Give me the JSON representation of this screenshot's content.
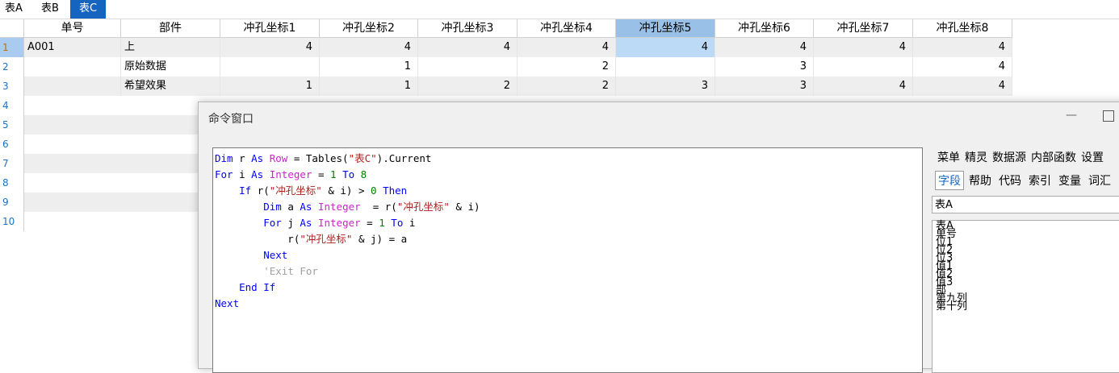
{
  "tabs": [
    {
      "label": "表A",
      "active": false
    },
    {
      "label": "表B",
      "active": false
    },
    {
      "label": "表C",
      "active": true
    }
  ],
  "grid": {
    "columns": [
      "单号",
      "部件",
      "冲孔坐标1",
      "冲孔坐标2",
      "冲孔坐标3",
      "冲孔坐标4",
      "冲孔坐标5",
      "冲孔坐标6",
      "冲孔坐标7",
      "冲孔坐标8"
    ],
    "selected_column": 6,
    "row_numbers": [
      "1",
      "2",
      "3",
      "4",
      "5",
      "6",
      "7",
      "8",
      "9",
      "10"
    ],
    "current_row": 0,
    "rows": [
      [
        "A001",
        "上",
        "4",
        "4",
        "4",
        "4",
        "4",
        "4",
        "4",
        "4"
      ],
      [
        "",
        "原始数据",
        "",
        "1",
        "",
        "2",
        "",
        "3",
        "",
        "4"
      ],
      [
        "",
        "希望效果",
        "1",
        "1",
        "2",
        "2",
        "3",
        "3",
        "4",
        "4"
      ]
    ]
  },
  "command_window": {
    "title": "命令窗口",
    "code": [
      [
        [
          "kw",
          "Dim"
        ],
        [
          "pl",
          " r "
        ],
        [
          "kw",
          "As"
        ],
        [
          "pl",
          " "
        ],
        [
          "ty",
          "Row"
        ],
        [
          "pl",
          " = Tables("
        ],
        [
          "st",
          "\"表C\""
        ],
        [
          "pl",
          ").Current"
        ]
      ],
      [
        [
          "kw",
          "For"
        ],
        [
          "pl",
          " i "
        ],
        [
          "kw",
          "As"
        ],
        [
          "pl",
          " "
        ],
        [
          "ty",
          "Integer"
        ],
        [
          "pl",
          " = "
        ],
        [
          "nm",
          "1"
        ],
        [
          "pl",
          " "
        ],
        [
          "kw",
          "To"
        ],
        [
          "pl",
          " "
        ],
        [
          "nm",
          "8"
        ]
      ],
      [
        [
          "pl",
          "    "
        ],
        [
          "kw",
          "If"
        ],
        [
          "pl",
          " r("
        ],
        [
          "st",
          "\"冲孔坐标\""
        ],
        [
          "pl",
          " & i) > "
        ],
        [
          "nm",
          "0"
        ],
        [
          "pl",
          " "
        ],
        [
          "kw",
          "Then"
        ]
      ],
      [
        [
          "pl",
          "        "
        ],
        [
          "kw",
          "Dim"
        ],
        [
          "pl",
          " a "
        ],
        [
          "kw",
          "As"
        ],
        [
          "pl",
          " "
        ],
        [
          "ty",
          "Integer"
        ],
        [
          "pl",
          "  = r("
        ],
        [
          "st",
          "\"冲孔坐标\""
        ],
        [
          "pl",
          " & i)"
        ]
      ],
      [
        [
          "pl",
          "        "
        ],
        [
          "kw",
          "For"
        ],
        [
          "pl",
          " j "
        ],
        [
          "kw",
          "As"
        ],
        [
          "pl",
          " "
        ],
        [
          "ty",
          "Integer"
        ],
        [
          "pl",
          " = "
        ],
        [
          "nm",
          "1"
        ],
        [
          "pl",
          " "
        ],
        [
          "kw",
          "To"
        ],
        [
          "pl",
          " i"
        ]
      ],
      [
        [
          "pl",
          "            r("
        ],
        [
          "st",
          "\"冲孔坐标\""
        ],
        [
          "pl",
          " & j) = a"
        ]
      ],
      [
        [
          "pl",
          "        "
        ],
        [
          "kw",
          "Next"
        ]
      ],
      [
        [
          "pl",
          "        "
        ],
        [
          "cm",
          "'Exit For"
        ]
      ],
      [
        [
          "pl",
          "    "
        ],
        [
          "kw",
          "End If"
        ]
      ],
      [
        [
          "kw",
          "Next"
        ]
      ]
    ],
    "menu": [
      "菜单",
      "精灵",
      "数据源",
      "内部函数",
      "设置"
    ],
    "panel_tabs": [
      {
        "label": "字段",
        "active": true
      },
      {
        "label": "帮助",
        "active": false
      },
      {
        "label": "代码",
        "active": false
      },
      {
        "label": "索引",
        "active": false
      },
      {
        "label": "变量",
        "active": false
      },
      {
        "label": "词汇",
        "active": false
      }
    ],
    "table_select": "表A",
    "fields": [
      "表A",
      "单号",
      "位1",
      "位2",
      "位3",
      "值1",
      "值2",
      "值3",
      "部",
      "第九列",
      "第十列"
    ]
  }
}
